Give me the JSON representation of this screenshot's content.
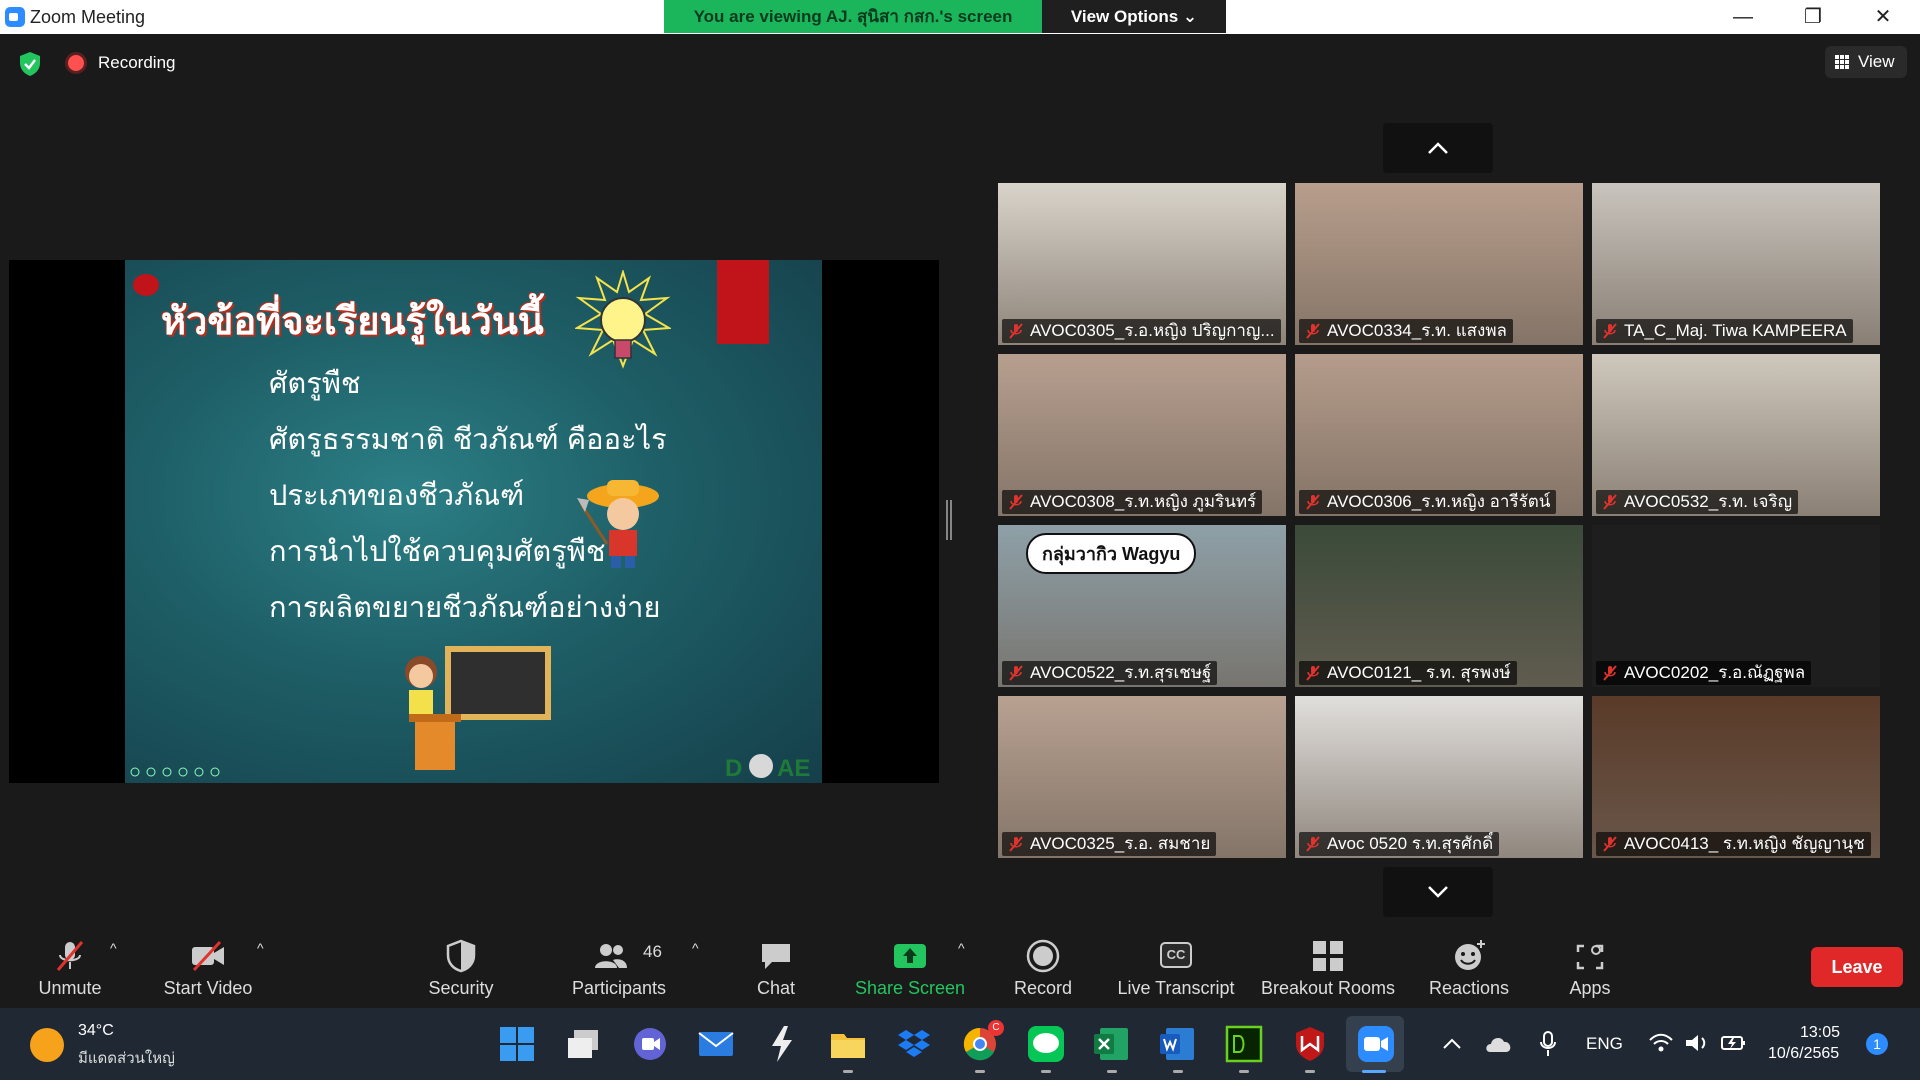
{
  "window": {
    "title": "Zoom Meeting",
    "banner": "You are viewing AJ. สุนิสา กสก.'s screen",
    "view_options": "View Options ⌄"
  },
  "status": {
    "recording": "Recording",
    "view": "View"
  },
  "slide": {
    "title": "หัวข้อที่จะเรียนรู้ในวันนี้",
    "bullets": [
      "ศัตรูพืช",
      "ศัตรูธรรมชาติ ชีวภัณฑ์ คืออะไร",
      "ประเภทของชีวภัณฑ์",
      "การนำไปใช้ควบคุมศัตรูพืช",
      "การผลิตขยายชีวภัณฑ์อย่างง่าย"
    ]
  },
  "participants": [
    {
      "name": "AVOC0305_ร.อ.หญิง ปริญกาญ...",
      "bg": "#d9d4cb"
    },
    {
      "name": "AVOC0334_ร.ท. แสงพล",
      "bg": "#b89e8c"
    },
    {
      "name": "TA_C_Maj. Tiwa KAMPEERA",
      "bg": "#c9c4bd"
    },
    {
      "name": "AVOC0308_ร.ท.หญิง ภูมรินทร์",
      "bg": "#b79f8f"
    },
    {
      "name": "AVOC0306_ร.ท.หญิง อารีรัตน์",
      "bg": "#b59c8b"
    },
    {
      "name": "AVOC0532_ร.ท. เจริญ",
      "bg": "#cfc8bc"
    },
    {
      "name": "AVOC0522_ร.ท.สุรเชษฐ์",
      "bg": "#8ea0a8",
      "caption": "กลุ่มวากิว Wagyu"
    },
    {
      "name": "AVOC0121_ ร.ท. สุรพงษ์",
      "bg": "#3b4a39"
    },
    {
      "name": "AVOC0202_ร.อ.ณัฏฐพล",
      "bg": "#1e1e1e"
    },
    {
      "name": "AVOC0325_ร.อ. สมชาย",
      "bg": "#b8a191"
    },
    {
      "name": "Avoc 0520 ร.ท.สุรศักดิ์",
      "bg": "#e1dfdc"
    },
    {
      "name": "AVOC0413_ ร.ท.หญิง ชัญญานุช",
      "bg": "#5a3a28"
    }
  ],
  "toolbar": {
    "unmute": "Unmute",
    "start_video": "Start Video",
    "security": "Security",
    "participants": "Participants",
    "participants_count": "46",
    "chat": "Chat",
    "share_screen": "Share Screen",
    "record": "Record",
    "live_transcript": "Live Transcript",
    "breakout_rooms": "Breakout Rooms",
    "reactions": "Reactions",
    "apps": "Apps",
    "leave": "Leave",
    "cc": "CC"
  },
  "taskbar": {
    "temp": "34°C",
    "weather": "มีแดดส่วนใหญ่",
    "lang": "ENG",
    "time": "13:05",
    "date": "10/6/2565",
    "notifications": "1",
    "chrome_badge": "C"
  },
  "colors": {
    "accent": "#2D8CFF",
    "banner": "#1BB55C",
    "leave": "#E02828",
    "muted": "#E0332E",
    "share": "#22C55E"
  }
}
